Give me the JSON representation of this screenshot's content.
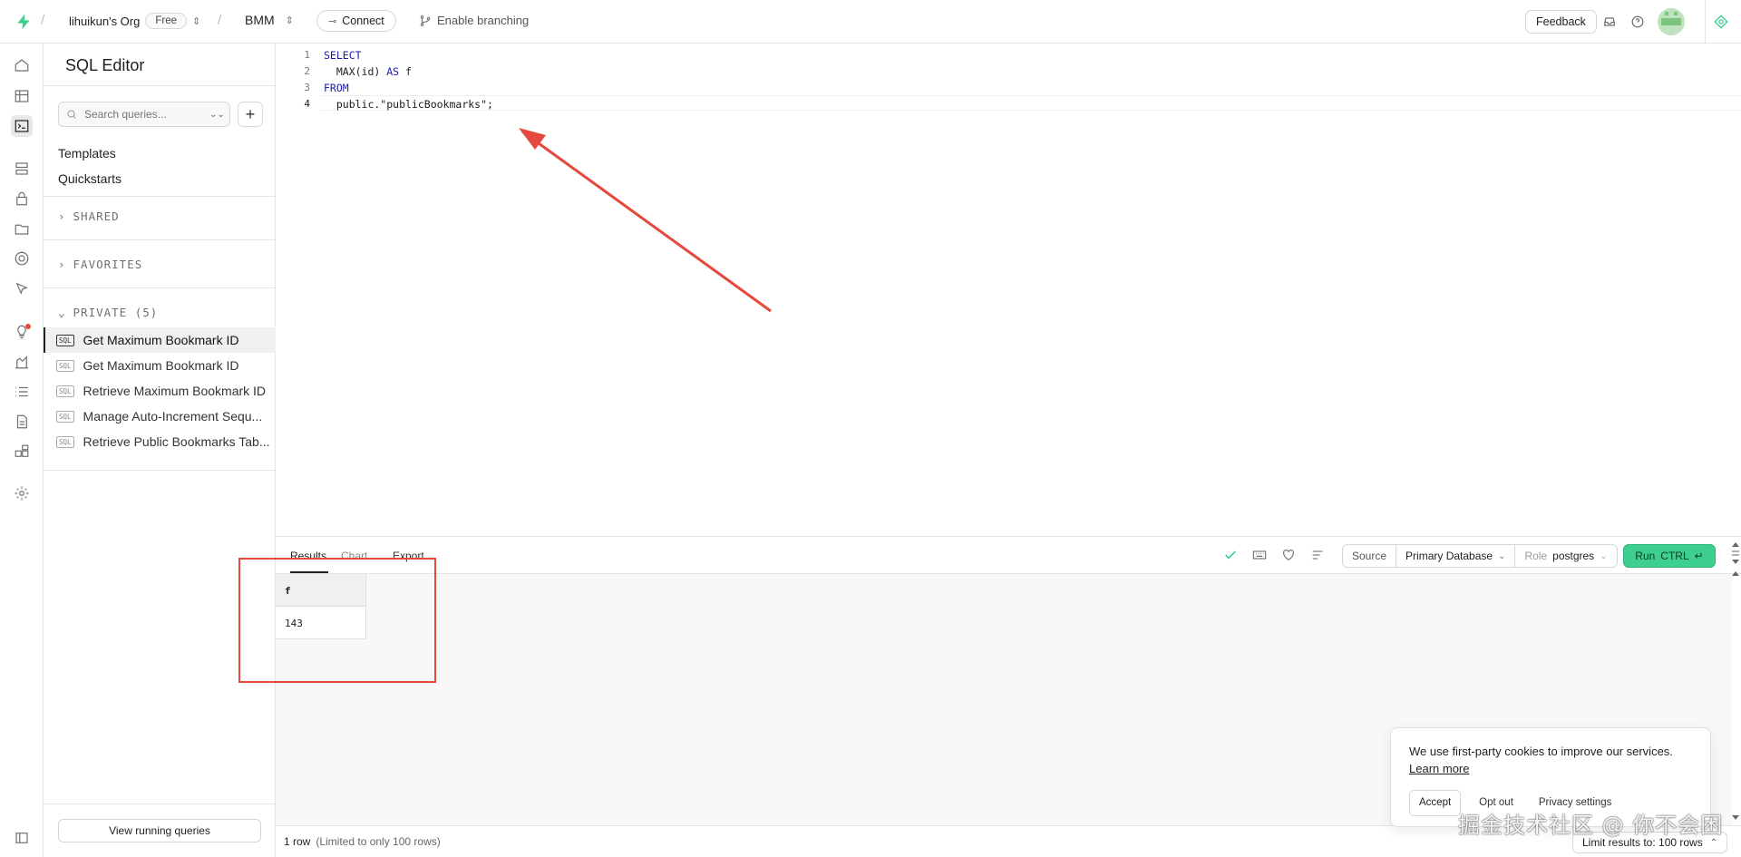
{
  "topbar": {
    "org_name": "lihuikun's Org",
    "plan_badge": "Free",
    "project_name": "BMM",
    "connect_label": "Connect",
    "branching_label": "Enable branching",
    "feedback_label": "Feedback"
  },
  "sidebar": {
    "title": "SQL Editor",
    "search_placeholder": "Search queries...",
    "links": [
      "Templates",
      "Quickstarts"
    ],
    "sections": {
      "shared": "SHARED",
      "favorites": "FAVORITES",
      "private": "PRIVATE (5)"
    },
    "queries": [
      {
        "label": "Get Maximum Bookmark ID",
        "badge": "SQL",
        "active": true
      },
      {
        "label": "Get Maximum Bookmark ID",
        "badge": "SQL",
        "active": false
      },
      {
        "label": "Retrieve Maximum Bookmark ID",
        "badge": "SQL",
        "active": false
      },
      {
        "label": "Manage Auto-Increment Sequ...",
        "badge": "SQL",
        "active": false
      },
      {
        "label": "Retrieve Public Bookmarks Tab...",
        "badge": "SQL",
        "active": false
      }
    ],
    "view_running_label": "View running queries"
  },
  "editor": {
    "line_numbers": [
      "1",
      "2",
      "3",
      "4"
    ],
    "lines": {
      "l1_kw": "SELECT",
      "l2_pre": "  MAX(id) ",
      "l2_kw": "AS",
      "l2_post": " f",
      "l3_kw": "FROM",
      "l4": "  public.\"publicBookmarks\";"
    }
  },
  "results_bar": {
    "tabs": [
      "Results",
      "Chart",
      "Export"
    ],
    "source_label": "Source",
    "database": "Primary Database",
    "role_label": "Role",
    "role_value": "postgres",
    "run_label": "Run",
    "run_shortcut": "CTRL"
  },
  "results": {
    "columns": [
      "f"
    ],
    "rows": [
      [
        "143"
      ]
    ]
  },
  "footer": {
    "row_count": "1 row",
    "limit_note": "(Limited to only 100 rows)",
    "limit_button": "Limit results to: 100 rows"
  },
  "cookie_banner": {
    "message": "We use first-party cookies to improve our services.",
    "learn_more": "Learn more",
    "accept": "Accept",
    "opt_out": "Opt out",
    "privacy_settings": "Privacy settings"
  },
  "watermark": "掘金技术社区 @ 你不会困",
  "colors": {
    "brand_green": "#3ecf8e",
    "annotation_red": "#e5483d",
    "keyword_blue": "#1c1ca8"
  }
}
